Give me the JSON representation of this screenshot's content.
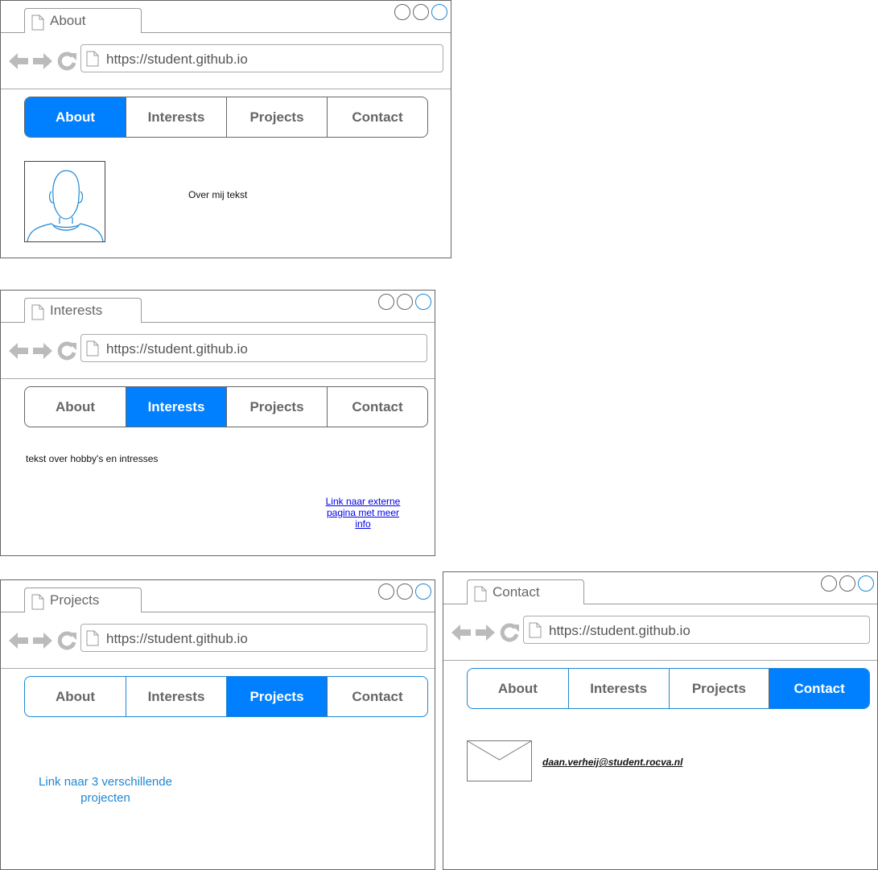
{
  "url": "https://student.github.io",
  "nav": [
    "About",
    "Interests",
    "Projects",
    "Contact"
  ],
  "windows": {
    "about": {
      "tab_title": "About",
      "about_text": "Over mij tekst"
    },
    "interests": {
      "tab_title": "Interests",
      "hobby_text": "tekst over hobby's en intresses",
      "ext_link_lines": [
        "Link naar externe",
        "pagina met meer",
        "info"
      ]
    },
    "projects": {
      "tab_title": "Projects",
      "projects_link_lines": [
        "Link naar 3 verschillende",
        "projecten"
      ]
    },
    "contact": {
      "tab_title": "Contact",
      "email": "daan.verheij@student.rocva.nl"
    }
  },
  "colors": {
    "accent": "#0080ff",
    "link_blue": "#1e88d4",
    "border": "#666666"
  },
  "icons": [
    "page-icon",
    "back-arrow-icon",
    "forward-arrow-icon",
    "reload-icon",
    "user-avatar-icon",
    "envelope-icon"
  ]
}
